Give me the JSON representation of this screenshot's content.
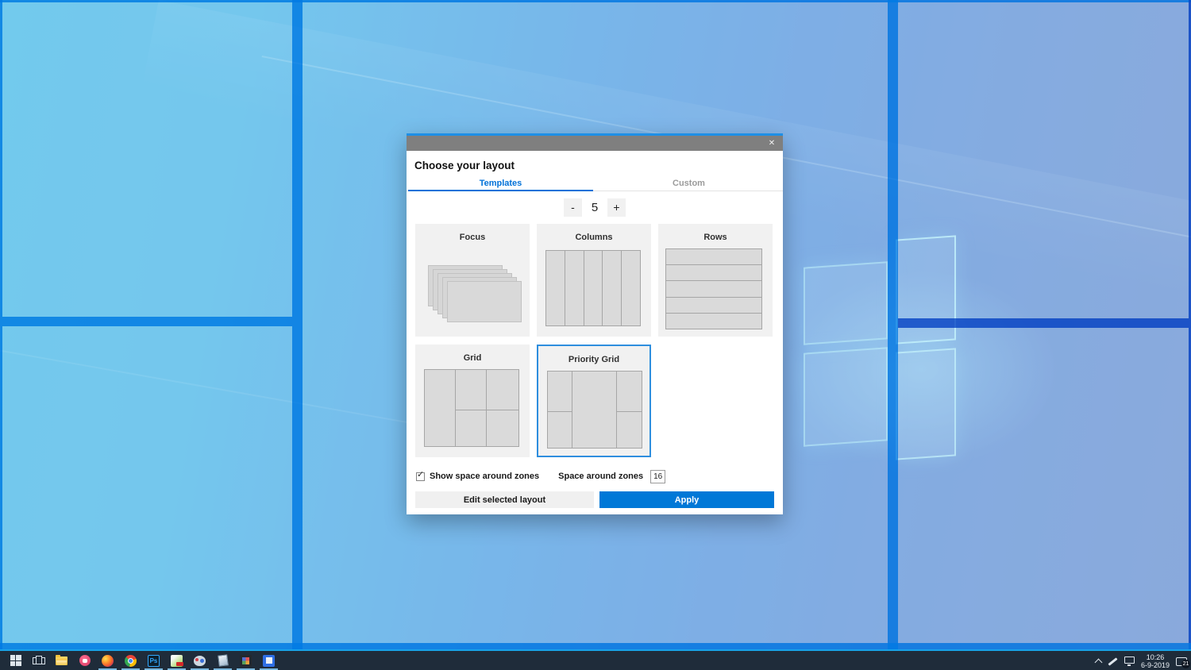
{
  "colors": {
    "accent": "#0078d7",
    "tab_blue": "#0071d8",
    "titlebar_gray": "#7f7f7f",
    "taskbar_bg": "#1f2c3a",
    "zone_band_blue": "#0f8ce4",
    "zone_fill_light": "#8ed2f0"
  },
  "dialog": {
    "close_glyph": "✕",
    "heading": "Choose your layout",
    "tabs": {
      "templates": "Templates",
      "custom": "Custom"
    },
    "spinner": {
      "minus": "-",
      "value": "5",
      "plus": "+"
    },
    "templates": [
      {
        "label": "Focus"
      },
      {
        "label": "Columns"
      },
      {
        "label": "Rows"
      },
      {
        "label": "Grid"
      },
      {
        "label": "Priority Grid",
        "selected": true
      }
    ],
    "options": {
      "checkbox_label": "Show space around zones",
      "checkbox_checked": true,
      "check_glyph": "✓",
      "space_label": "Space around zones",
      "space_value": "16"
    },
    "buttons": {
      "edit": "Edit selected layout",
      "apply": "Apply"
    }
  },
  "taskbar": {
    "photoshop_label": "Ps",
    "apps": [
      "start",
      "task-view",
      "file-explorer",
      "camera-app",
      "firefox",
      "chrome",
      "photoshop",
      "pdf-app",
      "paint-app",
      "notes-app",
      "grid-app",
      "window-app"
    ],
    "tray": {
      "time": "10:26",
      "date": "6-9-2019",
      "notification_count": "21"
    }
  }
}
